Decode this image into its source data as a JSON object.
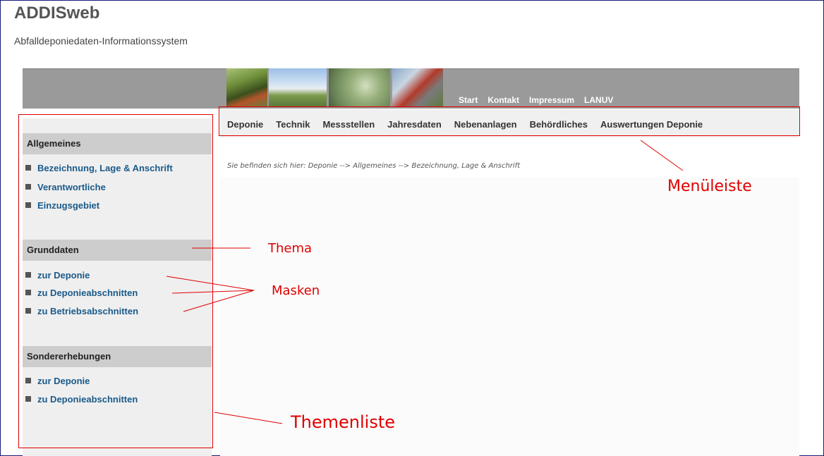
{
  "header": {
    "title": "ADDISweb",
    "subtitle": "Abfalldeponiedaten-Informationssystem"
  },
  "banner": {
    "photos": [
      "frog-photo",
      "landscape-photo",
      "plant-photo",
      "building-photo"
    ]
  },
  "top_nav": {
    "items": [
      "Start",
      "Kontakt",
      "Impressum",
      "LANUV"
    ]
  },
  "menu": {
    "items": [
      "Deponie",
      "Technik",
      "Messstellen",
      "Jahresdaten",
      "Nebenanlagen",
      "Behördliches",
      "Auswertungen Deponie"
    ]
  },
  "breadcrumb": "Sie befinden sich hier: Deponie --> Allgemeines --> Bezeichnung, Lage & Anschrift",
  "sidebar": {
    "sections": [
      {
        "title": "Allgemeines",
        "links": [
          "Bezeichnung, Lage & Anschrift",
          "Verantwortliche",
          "Einzugsgebiet"
        ]
      },
      {
        "title": "Grunddaten",
        "links": [
          "zur Deponie",
          "zu Deponieabschnitten",
          "zu Betriebsabschnitten"
        ]
      },
      {
        "title": "Sondererhebungen",
        "links": [
          "zur Deponie",
          "zu Deponieabschnitten"
        ]
      }
    ]
  },
  "annotations": {
    "menuleiste": "Menüleiste",
    "thema": "Thema",
    "masken": "Masken",
    "themenliste": "Themenliste"
  },
  "colors": {
    "annotation": "#e00000",
    "link": "#1a5a8a",
    "banner": "#9a9a9a",
    "sidebar_bg": "#efefef",
    "section_header_bg": "#cdcdcd"
  }
}
